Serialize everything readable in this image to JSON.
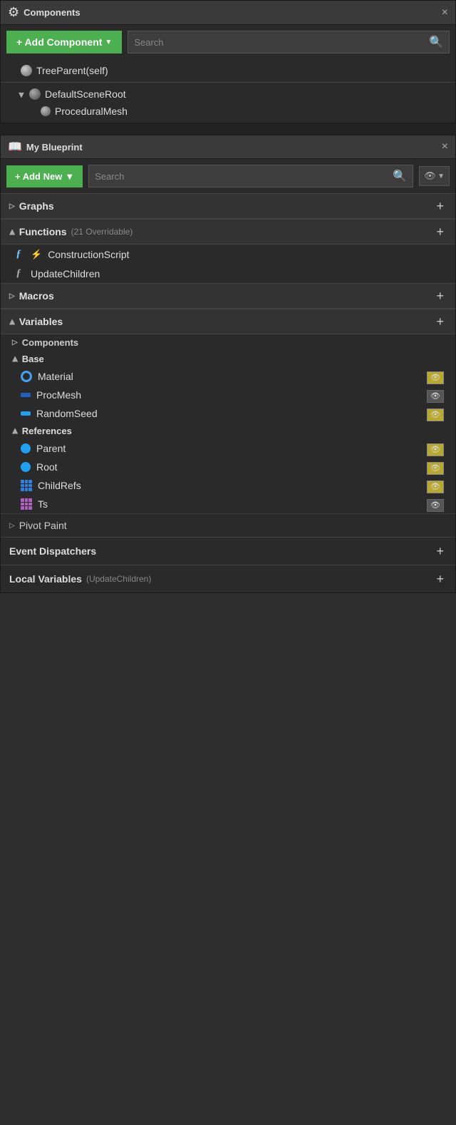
{
  "components_panel": {
    "title": "Components",
    "close_label": "×",
    "add_component_label": "+ Add Component",
    "dropdown_arrow": "▼",
    "search_placeholder": "Search",
    "search_icon": "🔍",
    "tree": [
      {
        "label": "TreeParent(self)",
        "indent": 0,
        "has_arrow": false,
        "icon": "sphere"
      },
      {
        "label": "DefaultSceneRoot",
        "indent": 1,
        "has_arrow": true,
        "arrow": "◀",
        "icon": "gear-sphere"
      },
      {
        "label": "ProceduralMesh",
        "indent": 2,
        "has_arrow": false,
        "icon": "sphere-small"
      }
    ]
  },
  "my_blueprint_panel": {
    "title": "My Blueprint",
    "close_label": "×",
    "add_new_label": "+ Add New",
    "dropdown_arrow": "▼",
    "search_placeholder": "Search",
    "search_icon": "🔍",
    "eye_label": "👁",
    "eye_dropdown": "▼",
    "sections": [
      {
        "name": "Graphs",
        "has_arrow": true,
        "arrow": "▷",
        "collapsed": true,
        "show_add": true
      },
      {
        "name": "Functions",
        "has_arrow": true,
        "arrow": "◀",
        "collapsed": false,
        "subtitle": "(21 Overridable)",
        "show_add": true,
        "items": [
          {
            "label": "ConstructionScript",
            "icon": "construction"
          },
          {
            "label": "UpdateChildren",
            "icon": "function"
          }
        ]
      },
      {
        "name": "Macros",
        "has_arrow": true,
        "arrow": "▷",
        "collapsed": true,
        "show_add": true
      },
      {
        "name": "Variables",
        "has_arrow": true,
        "arrow": "◀",
        "collapsed": false,
        "show_add": true,
        "subsections": [
          {
            "label": "Components",
            "arrow": "▷",
            "collapsed": true
          },
          {
            "label": "Base",
            "arrow": "◀",
            "collapsed": false,
            "items": [
              {
                "label": "Material",
                "icon": "ring",
                "eye_visible": true
              },
              {
                "label": "ProcMesh",
                "icon": "bar",
                "eye_visible": false
              },
              {
                "label": "RandomSeed",
                "icon": "bar-blue",
                "eye_visible": true
              }
            ]
          },
          {
            "label": "References",
            "arrow": "◀",
            "collapsed": false,
            "items": [
              {
                "label": "Parent",
                "icon": "dot-blue-bright",
                "eye_visible": true
              },
              {
                "label": "Root",
                "icon": "dot-blue-bright",
                "eye_visible": true
              },
              {
                "label": "ChildRefs",
                "icon": "grid",
                "eye_visible": true
              },
              {
                "label": "Ts",
                "icon": "grid-alt",
                "eye_visible": false
              }
            ]
          }
        ]
      }
    ],
    "pivot_paint_label": "Pivot Paint",
    "event_dispatchers_label": "Event Dispatchers",
    "local_variables_label": "Local Variables",
    "local_variables_subtitle": "(UpdateChildren)"
  }
}
